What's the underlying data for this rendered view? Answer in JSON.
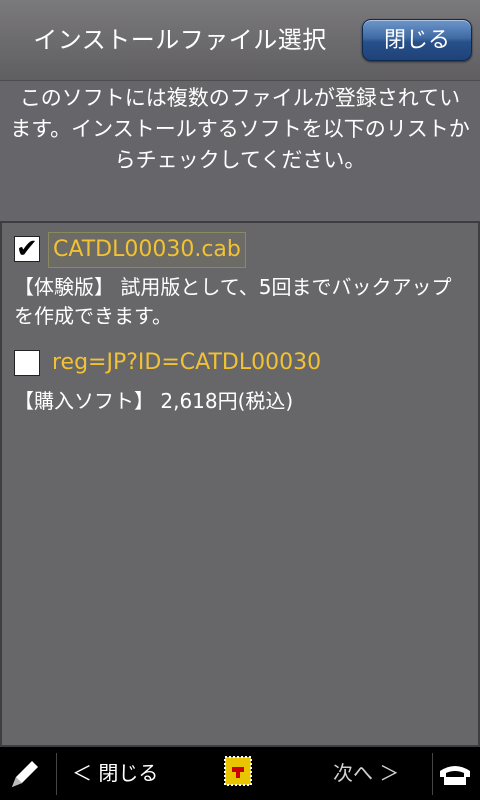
{
  "header": {
    "title": "インストールファイル選択",
    "close_label": "閉じる"
  },
  "description": "このソフトには複数のファイルが登録されています。インストールするソフトを以下のリストからチェックしてください。",
  "items": [
    {
      "name": "CATDL00030.cab",
      "checked": true,
      "description": "【体験版】 試用版として、5回までバックアップを作成できます。"
    },
    {
      "name": "reg=JP?ID=CATDL00030",
      "checked": false,
      "description": "【購入ソフト】 2,618円(税込)"
    }
  ],
  "bottom_bar": {
    "back_label": "＜ 閉じる",
    "next_label": "次へ ＞",
    "icons": [
      "pen-icon",
      "app-icon",
      "phone-icon"
    ]
  },
  "colors": {
    "background": "#666569",
    "item_name": "#f2c234",
    "button_blue": "#3f6aa3"
  }
}
